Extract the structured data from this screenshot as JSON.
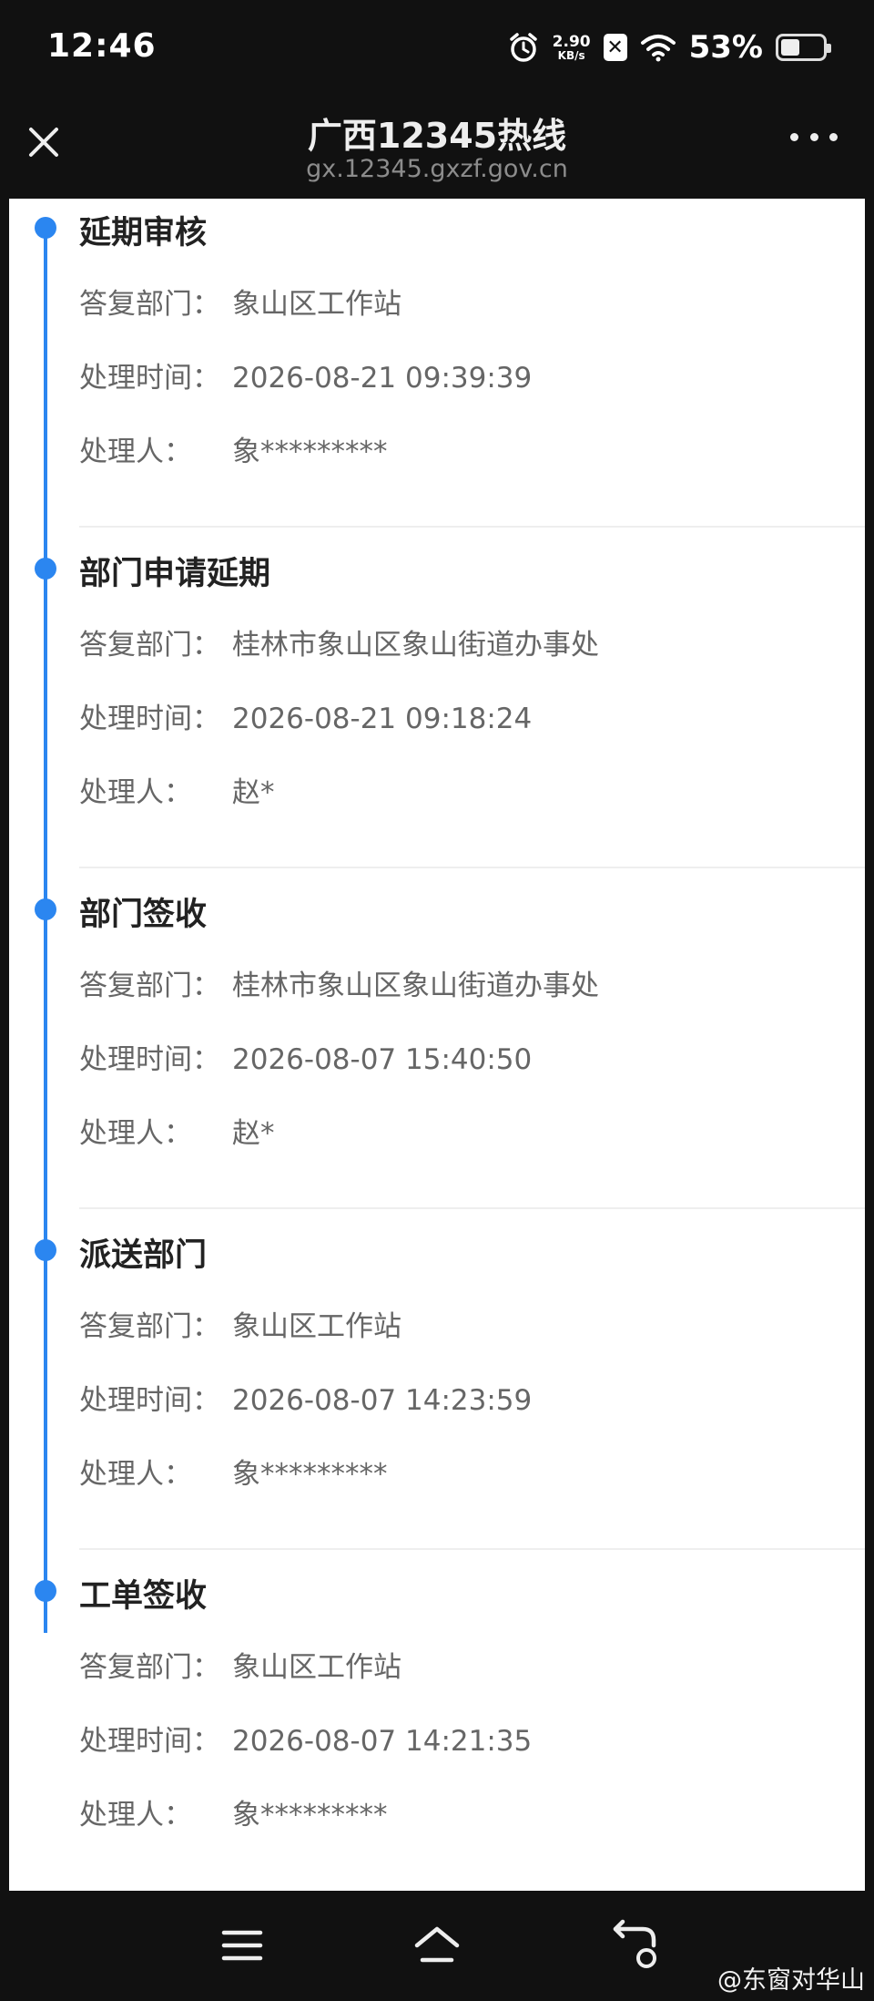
{
  "status_bar": {
    "time": "12:46",
    "net_speed_value": "2.90",
    "net_speed_unit": "KB/s",
    "battery_percent": "53%",
    "battery_level": 0.53
  },
  "header": {
    "title": "广西12345热线",
    "url": "gx.12345.gxzf.gov.cn"
  },
  "timeline": [
    {
      "title": "延期审核",
      "dept_label": "答复部门：",
      "dept": "象山区工作站",
      "time_label": "处理时间：",
      "time": "2026-08-21 09:39:39",
      "person_label": "处理人：",
      "person": "象*********"
    },
    {
      "title": "部门申请延期",
      "dept_label": "答复部门：",
      "dept": "桂林市象山区象山街道办事处",
      "time_label": "处理时间：",
      "time": "2026-08-21 09:18:24",
      "person_label": "处理人：",
      "person": "赵*"
    },
    {
      "title": "部门签收",
      "dept_label": "答复部门：",
      "dept": "桂林市象山区象山街道办事处",
      "time_label": "处理时间：",
      "time": "2026-08-07 15:40:50",
      "person_label": "处理人：",
      "person": "赵*"
    },
    {
      "title": "派送部门",
      "dept_label": "答复部门：",
      "dept": "象山区工作站",
      "time_label": "处理时间：",
      "time": "2026-08-07 14:23:59",
      "person_label": "处理人：",
      "person": "象*********"
    },
    {
      "title": "工单签收",
      "dept_label": "答复部门：",
      "dept": "象山区工作站",
      "time_label": "处理时间：",
      "time": "2026-08-07 14:21:35",
      "person_label": "处理人：",
      "person": "象*********"
    }
  ],
  "watermark": "@东窗对华山",
  "colors": {
    "accent": "#2b86f0",
    "background_dark": "#111111",
    "card": "#ffffff"
  }
}
